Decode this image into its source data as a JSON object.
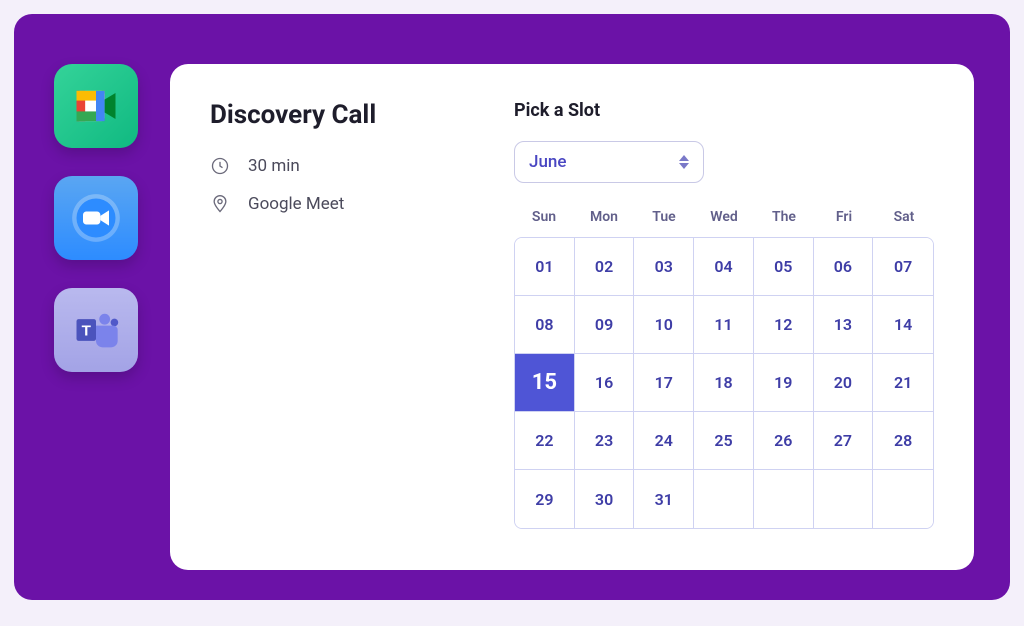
{
  "sidebar": {
    "apps": [
      {
        "name": "Google Meet"
      },
      {
        "name": "Zoom"
      },
      {
        "name": "Microsoft Teams"
      }
    ]
  },
  "event": {
    "title": "Discovery Call",
    "duration": "30 min",
    "location": "Google Meet"
  },
  "slot": {
    "label": "Pick a Slot",
    "month": "June",
    "dow": [
      "Sun",
      "Mon",
      "Tue",
      "Wed",
      "The",
      "Fri",
      "Sat"
    ],
    "selected": "15",
    "days": [
      "01",
      "02",
      "03",
      "04",
      "05",
      "06",
      "07",
      "08",
      "09",
      "10",
      "11",
      "12",
      "13",
      "14",
      "15",
      "16",
      "17",
      "18",
      "19",
      "20",
      "21",
      "22",
      "23",
      "24",
      "25",
      "26",
      "27",
      "28",
      "29",
      "30",
      "31",
      "",
      "",
      "",
      ""
    ]
  }
}
